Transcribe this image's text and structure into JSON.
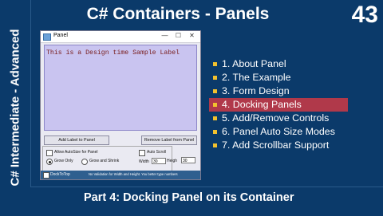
{
  "side_label": "C# Intermediate - Advanced",
  "header": {
    "title": "C# Containers - Panels",
    "episode": "43"
  },
  "window": {
    "title": "Panel",
    "controls": [
      "—",
      "☐",
      "✕"
    ],
    "sample_label": "This is a Design time Sample Label",
    "add_button": "Add Label to Panel",
    "remove_button": "Remove Label from Panel",
    "allow_autosize": "Allow AutoSize for Panel",
    "grow_only": "Grow Only",
    "grow_and_shrink": "Grow and Shrink",
    "auto_scroll": "Auto Scroll",
    "width_label": "Width",
    "width_value": "30",
    "height_label": "Heigh",
    "height_value": "30",
    "dock_top": "DockToTop",
    "status_text": "No Validation for Width and Height. You better type numbers"
  },
  "menu": {
    "items": [
      "1. About Panel",
      "2. The Example",
      "3. Form Design",
      "4. Docking Panels",
      "5. Add/Remove Controls",
      "6. Panel Auto Size Modes",
      "7. Add Scrollbar Support"
    ],
    "active_index": 3,
    "bullet_color": "#f2c12e",
    "active_color": "#b0394a"
  },
  "footer": {
    "subtitle": "Part 4: Docking Panel on its Container"
  },
  "colors": {
    "background": "#0b3a6a",
    "panel": "#c9c4f0"
  }
}
